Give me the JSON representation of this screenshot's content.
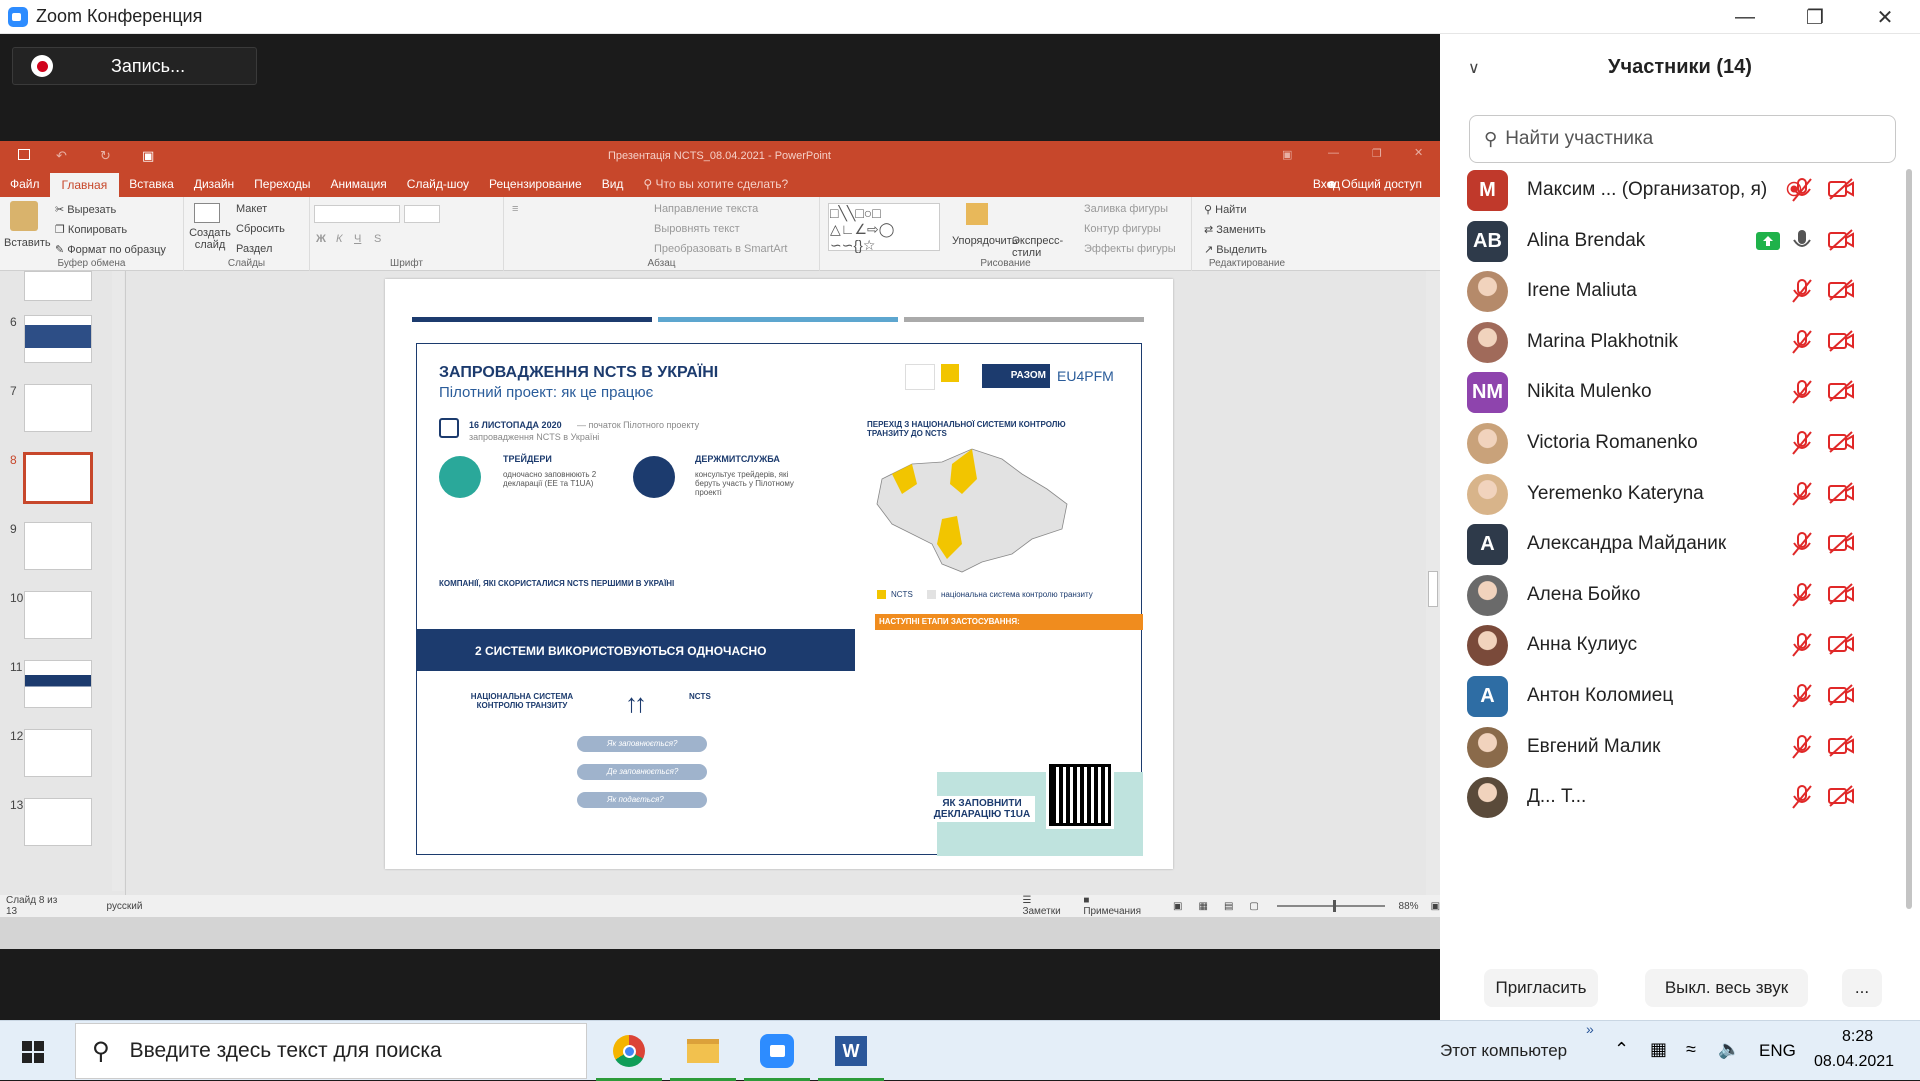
{
  "zoom": {
    "window_title": "Zoom Конференция",
    "recording_label": "Запись..."
  },
  "ppt": {
    "title": "Презентація NCTS_08.04.2021 - PowerPoint",
    "tabs": [
      "Файл",
      "Главная",
      "Вставка",
      "Дизайн",
      "Переходы",
      "Анимация",
      "Слайд-шоу",
      "Рецензирование",
      "Вид"
    ],
    "tell_me": "Что вы хотите сделать?",
    "login": "Вход",
    "share": "Общий доступ",
    "ribbon": {
      "paste": "Вставить",
      "cut": "Вырезать",
      "copy": "Копировать",
      "format_painter": "Формат по образцу",
      "clipboard_label": "Буфер обмена",
      "new_slide": "Создать слайд",
      "layout": "Макет",
      "reset": "Сбросить",
      "section": "Раздел",
      "slides_label": "Слайды",
      "font_label": "Шрифт",
      "text_direction": "Направление текста",
      "align_text": "Выровнять текст",
      "smartart": "Преобразовать в SmartArt",
      "paragraph_label": "Абзац",
      "arrange": "Упорядочить",
      "quick_styles": "Экспресс-стили",
      "shape_fill": "Заливка фигуры",
      "shape_outline": "Контур фигуры",
      "shape_effects": "Эффекты фигуры",
      "drawing_label": "Рисование",
      "find": "Найти",
      "replace": "Заменить",
      "select": "Выделить",
      "editing_label": "Редактирование"
    },
    "thumbs": [
      "6",
      "7",
      "8",
      "9",
      "10",
      "11",
      "12",
      "13"
    ],
    "status": {
      "slide_of": "Слайд 8 из 13",
      "language": "русский",
      "notes": "Заметки",
      "comments": "Примечания",
      "zoom": "88%"
    }
  },
  "slide": {
    "title": "ЗАПРОВАДЖЕННЯ NCTS В УКРАЇНІ",
    "subtitle": "Пілотний проект: як це працює",
    "date_line": "16 ЛИСТОПАДА 2020",
    "date_note": "— початок Пілотного проекту",
    "date_sub": "запровадження NCTS в Україні",
    "traders": "ТРЕЙДЕРИ",
    "traders_text": "одночасно заповнюють 2 декларації (ЕЕ та T1UA)",
    "customs": "ДЕРЖМИТСЛУЖБА",
    "customs_text": "консультує трейдерів, які беруть участь у Пілотному проекті",
    "map_title": "ПЕРЕХІД З НАЦІОНАЛЬНОЇ СИСТЕМИ КОНТРОЛЮ ТРАНЗИТУ ДО NCTS",
    "companies": "КОМПАНІЇ, ЯКІ СКОРИСТАЛИСЯ NCTS ПЕРШИМИ В УКРАЇНІ",
    "banner": "2 СИСТЕМИ ВИКОРИСТОВУЮТЬСЯ ОДНОЧАСНО",
    "next_stages": "НАСТУПНІ ЕТАПИ ЗАСТОСУВАННЯ:",
    "legend_ncts": "NCTS",
    "legend_nat": "національна система контролю транзиту",
    "national": "НАЦІОНАЛЬНА СИСТЕМА КОНТРОЛЮ ТРАНЗИТУ",
    "ncts": "NCTS",
    "q1": "Як заповнюється?",
    "q2": "Де заповнюється?",
    "q3": "Як подається?",
    "how_fill": "ЯК ЗАПОВНИТИ ДЕКЛАРАЦІЮ T1UA",
    "logo_razom": "РАЗОМ",
    "logo_eu": "EU4PFM"
  },
  "participants": {
    "header": "Участники (14)",
    "search_placeholder": "Найти участника",
    "list": [
      {
        "name": "Максим ...  (Организатор, я)",
        "initials": "М",
        "color": "#c0392b",
        "photo": false
      },
      {
        "name": "Alina Brendak",
        "initials": "AB",
        "color": "#2e3a4a",
        "photo": false
      },
      {
        "name": "Irene Maliuta",
        "initials": "",
        "color": "#b58a6a",
        "photo": true
      },
      {
        "name": "Marina Plakhotnik",
        "initials": "",
        "color": "#a06a5a",
        "photo": true
      },
      {
        "name": "Nikita Mulenko",
        "initials": "NM",
        "color": "#8e44ad",
        "photo": false
      },
      {
        "name": "Victoria Romanenko",
        "initials": "",
        "color": "#c9a27a",
        "photo": true
      },
      {
        "name": "Yeremenko Kateryna",
        "initials": "",
        "color": "#d8b48a",
        "photo": true
      },
      {
        "name": "Александра Майданик",
        "initials": "А",
        "color": "#2e3a4a",
        "photo": false
      },
      {
        "name": "Алена Бойко",
        "initials": "",
        "color": "#6a6a6a",
        "photo": true
      },
      {
        "name": "Анна Кулиус",
        "initials": "",
        "color": "#7a4a3a",
        "photo": true
      },
      {
        "name": "Антон Коломиец",
        "initials": "А",
        "color": "#2e6da4",
        "photo": false
      },
      {
        "name": "Евгений Малик",
        "initials": "",
        "color": "#8a6a4a",
        "photo": true
      },
      {
        "name": "Д... Т...",
        "initials": "",
        "color": "#5a4a3a",
        "photo": true
      }
    ],
    "invite": "Пригласить",
    "mute_all": "Выкл. весь звук",
    "more": "..."
  },
  "taskbar": {
    "search_placeholder": "Введите здесь текст для поиска",
    "this_pc": "Этот компьютер",
    "lang": "ENG",
    "time": "8:28",
    "date": "08.04.2021"
  }
}
